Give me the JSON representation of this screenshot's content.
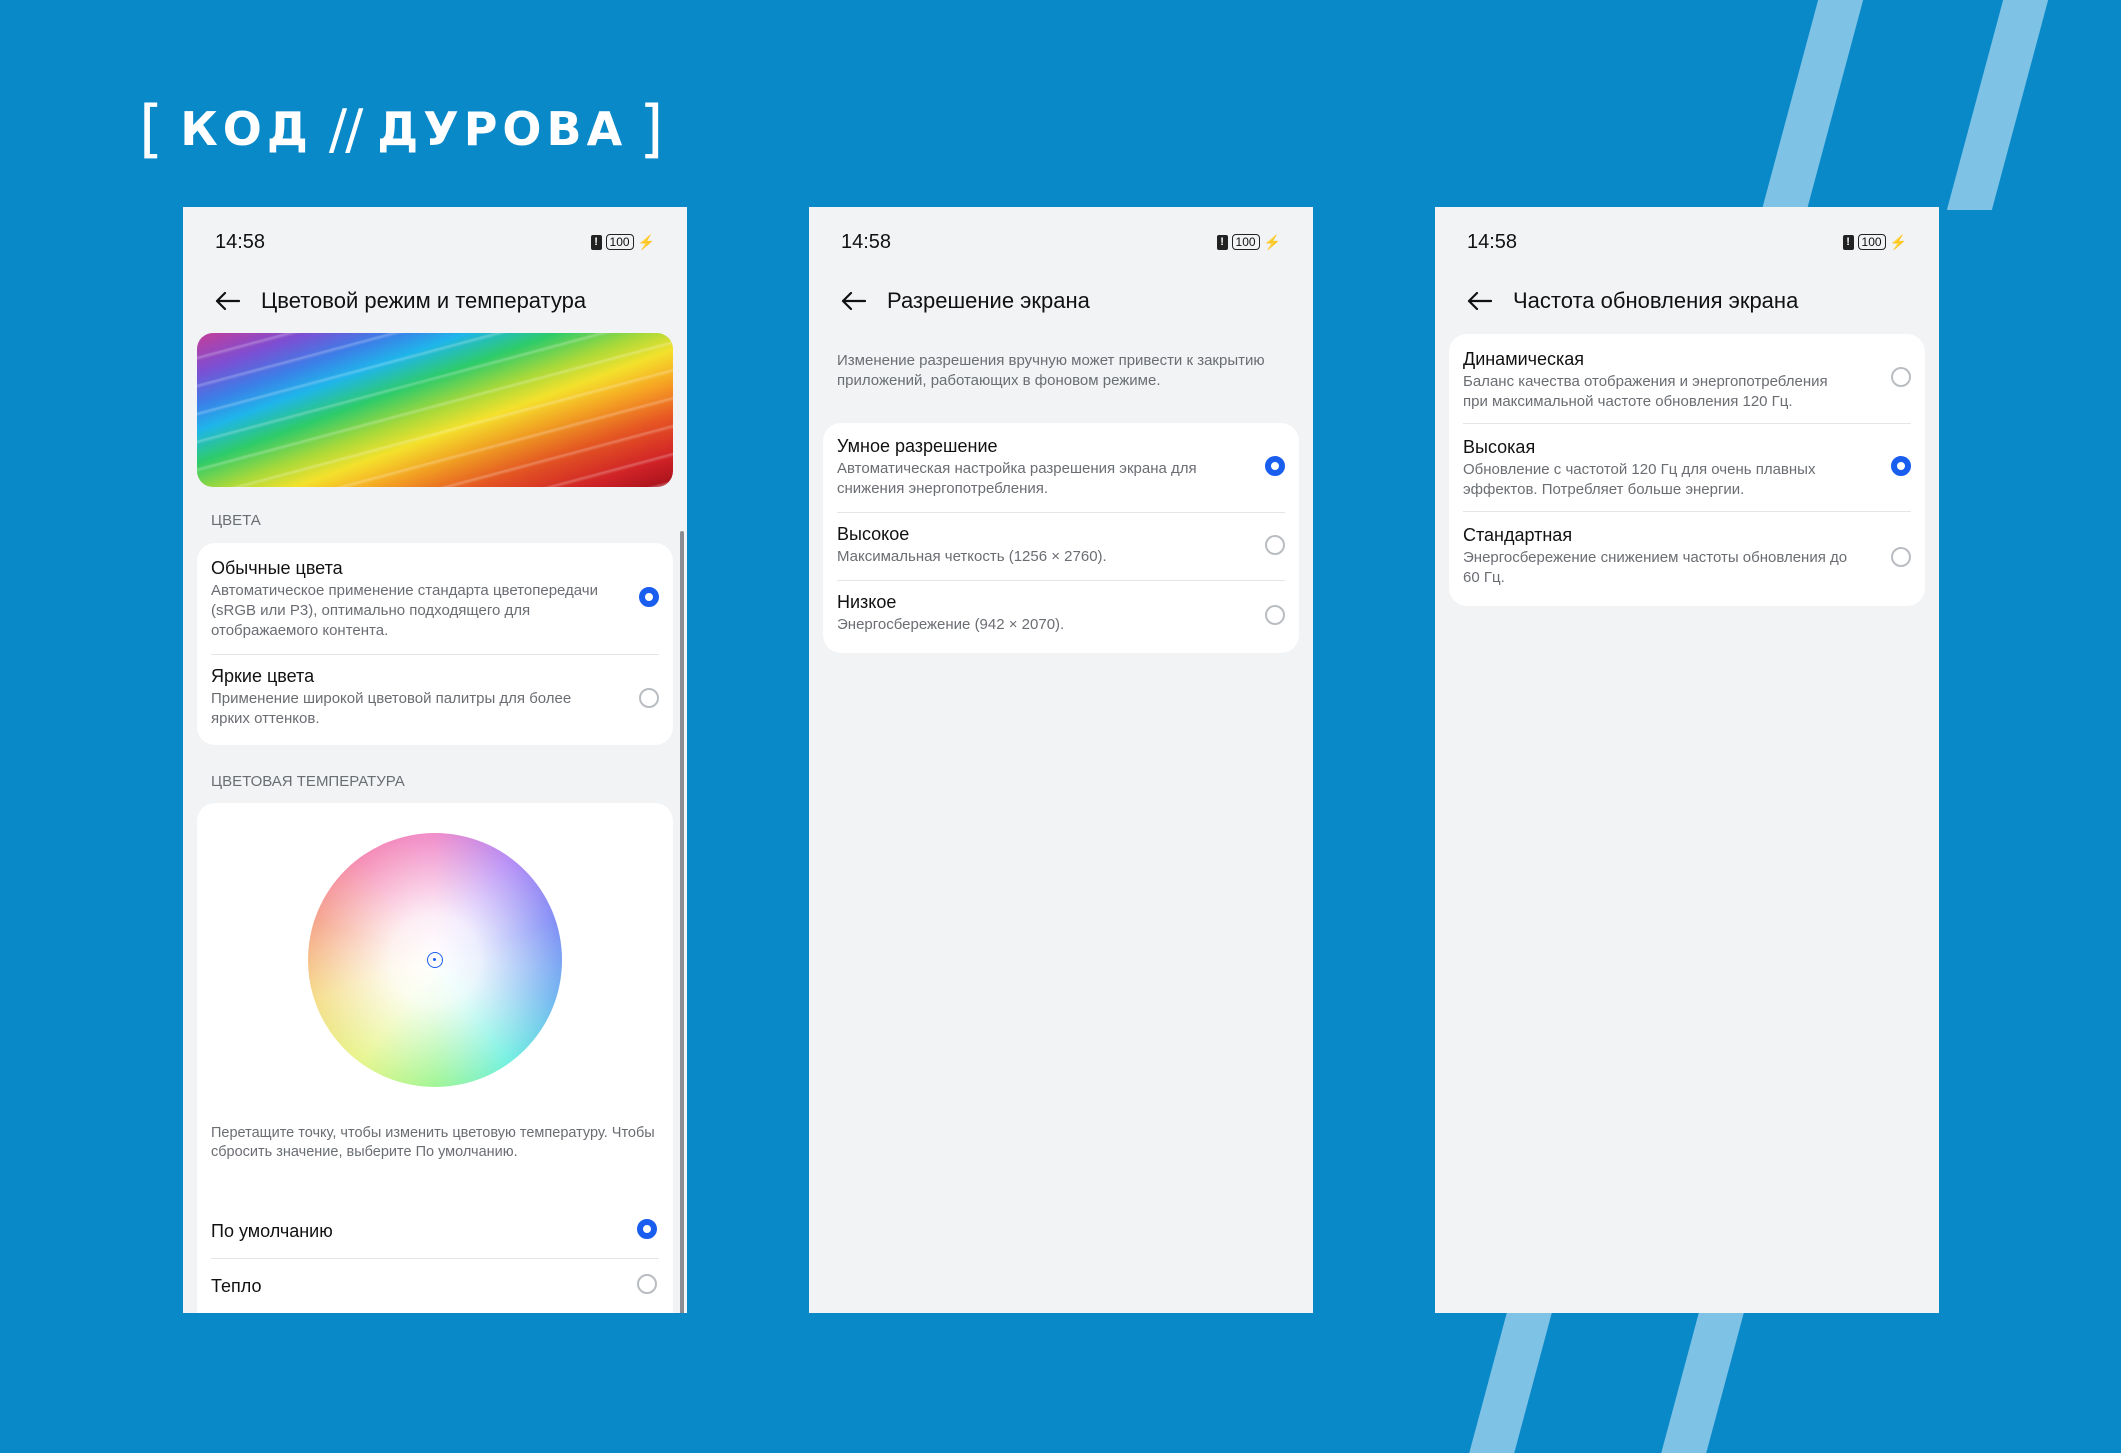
{
  "brand": {
    "bracket_left": "[",
    "word1": "КОД",
    "slashes": "//",
    "word2": "ДУРОВА",
    "bracket_right": "]"
  },
  "status": {
    "time": "14:58",
    "alert": "!",
    "battery": "100",
    "charging": "⚡"
  },
  "phone1": {
    "title": "Цветовой режим и температура",
    "colors_section": "ЦВЕТА",
    "colors": [
      {
        "title": "Обычные цвета",
        "subtitle": "Автоматическое применение стандарта цветопередачи (sRGB или P3), оптимально подходящего для отображаемого контента.",
        "selected": true
      },
      {
        "title": "Яркие цвета",
        "subtitle": "Применение широкой цветовой палитры для более ярких оттенков.",
        "selected": false
      }
    ],
    "temp_section": "ЦВЕТОВАЯ ТЕМПЕРАТУРА",
    "temp_note": "Перетащите точку, чтобы изменить цветовую температуру. Чтобы сбросить значение, выберите По умолчанию.",
    "temps": [
      {
        "title": "По умолчанию",
        "selected": true
      },
      {
        "title": "Тепло",
        "selected": false
      }
    ]
  },
  "phone2": {
    "title": "Разрешение экрана",
    "note": "Изменение разрешения вручную может привести к закрытию приложений, работающих в фоновом режиме.",
    "options": [
      {
        "title": "Умное разрешение",
        "subtitle": "Автоматическая настройка разрешения экрана для снижения энергопотребления.",
        "selected": true
      },
      {
        "title": "Высокое",
        "subtitle": "Максимальная четкость (1256 × 2760).",
        "selected": false
      },
      {
        "title": "Низкое",
        "subtitle": "Энергосбережение (942 × 2070).",
        "selected": false
      }
    ]
  },
  "phone3": {
    "title": "Частота обновления экрана",
    "options": [
      {
        "title": "Динамическая",
        "subtitle": "Баланс качества отображения и энергопотребления при максимальной частоте обновления 120 Гц.",
        "selected": false
      },
      {
        "title": "Высокая",
        "subtitle": "Обновление с частотой 120 Гц для очень плавных эффектов. Потребляет больше энергии.",
        "selected": true
      },
      {
        "title": "Стандартная",
        "subtitle": "Энергосбережение снижением частоты обновления до 60 Гц.",
        "selected": false
      }
    ]
  },
  "colors": {
    "background": "#0a89c9",
    "accent": "#1a5ef0",
    "stripe": "#7ec2e6"
  }
}
